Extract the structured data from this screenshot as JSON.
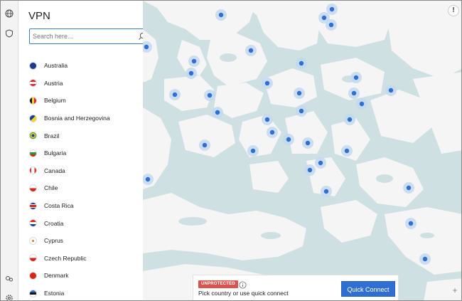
{
  "panel": {
    "title": "VPN",
    "search_placeholder": "Search here..."
  },
  "countries": [
    {
      "name": "Australia",
      "flag": "australia"
    },
    {
      "name": "Austria",
      "flag": "austria"
    },
    {
      "name": "Belgium",
      "flag": "belgium"
    },
    {
      "name": "Bosnia and Herzegovina",
      "flag": "bosnia"
    },
    {
      "name": "Brazil",
      "flag": "brazil"
    },
    {
      "name": "Bulgaria",
      "flag": "bulgaria"
    },
    {
      "name": "Canada",
      "flag": "canada"
    },
    {
      "name": "Chile",
      "flag": "chile"
    },
    {
      "name": "Costa Rica",
      "flag": "costa-rica"
    },
    {
      "name": "Croatia",
      "flag": "croatia"
    },
    {
      "name": "Cyprus",
      "flag": "cyprus"
    },
    {
      "name": "Czech Republic",
      "flag": "czech"
    },
    {
      "name": "Denmark",
      "flag": "denmark"
    },
    {
      "name": "Estonia",
      "flag": "estonia"
    }
  ],
  "status": {
    "badge": "UNPROTECTED",
    "message": "Pick country or use quick connect",
    "quick_connect": "Quick Connect"
  },
  "map": {
    "alert_label": "!",
    "zoom_label": "+"
  },
  "colors": {
    "accent": "#2f6fd1",
    "danger": "#d9534f",
    "water": "#cfe0e3",
    "land": "#f5f5f5",
    "pin": "#2f6fd1"
  },
  "icons": {
    "rail": [
      "globe-icon",
      "shield-icon",
      "meshnet-icon",
      "settings-icon"
    ],
    "search": "search-icon",
    "info": "info-icon"
  }
}
